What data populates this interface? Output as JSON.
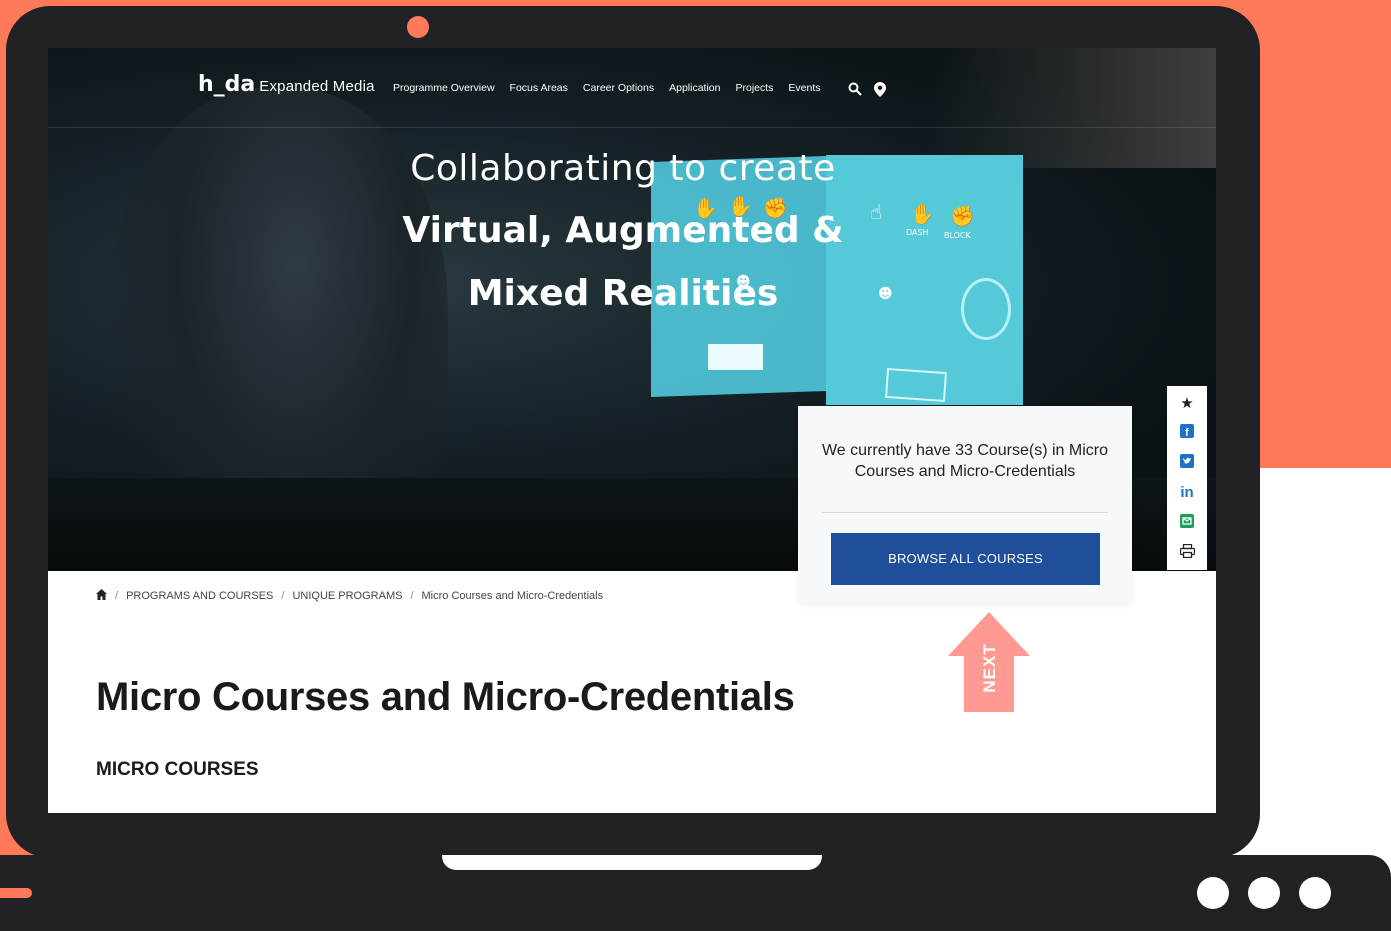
{
  "nav": {
    "logo_main": "h_da",
    "logo_sub": "Expanded Media",
    "items": [
      "Programme Overview",
      "Focus Areas",
      "Career Options",
      "Application",
      "Projects",
      "Events"
    ],
    "icons": [
      "search-icon",
      "location-pin-icon"
    ]
  },
  "hero": {
    "line1": "Collaborating to create",
    "line2": "Virtual, Augmented & Mixed Realities",
    "monitor_labels": [
      "DASH",
      "BLOCK"
    ]
  },
  "share": {
    "icons": [
      "star-icon",
      "facebook-icon",
      "twitter-icon",
      "linkedin-icon",
      "email-icon",
      "print-icon"
    ],
    "colors": {
      "star": "#222222",
      "social": "#1a73c9",
      "email": "#1e9e5a"
    }
  },
  "course_card": {
    "text": "We currently have 33 Course(s) in Micro Courses and Micro-Credentials",
    "button": "BROWSE ALL COURSES",
    "button_color": "#1f4f9a"
  },
  "breadcrumb": {
    "home_icon": "home-icon",
    "items": [
      "PROGRAMS AND COURSES",
      "UNIQUE PROGRAMS",
      "Micro Courses and Micro-Credentials"
    ]
  },
  "page": {
    "title": "Micro Courses and Micro-Credentials",
    "section": "MICRO COURSES"
  },
  "next_arrow": {
    "label": "NEXT",
    "color": "#ff9a92"
  },
  "frame": {
    "accent": "#ff7a59",
    "laptop_color": "#222226"
  }
}
